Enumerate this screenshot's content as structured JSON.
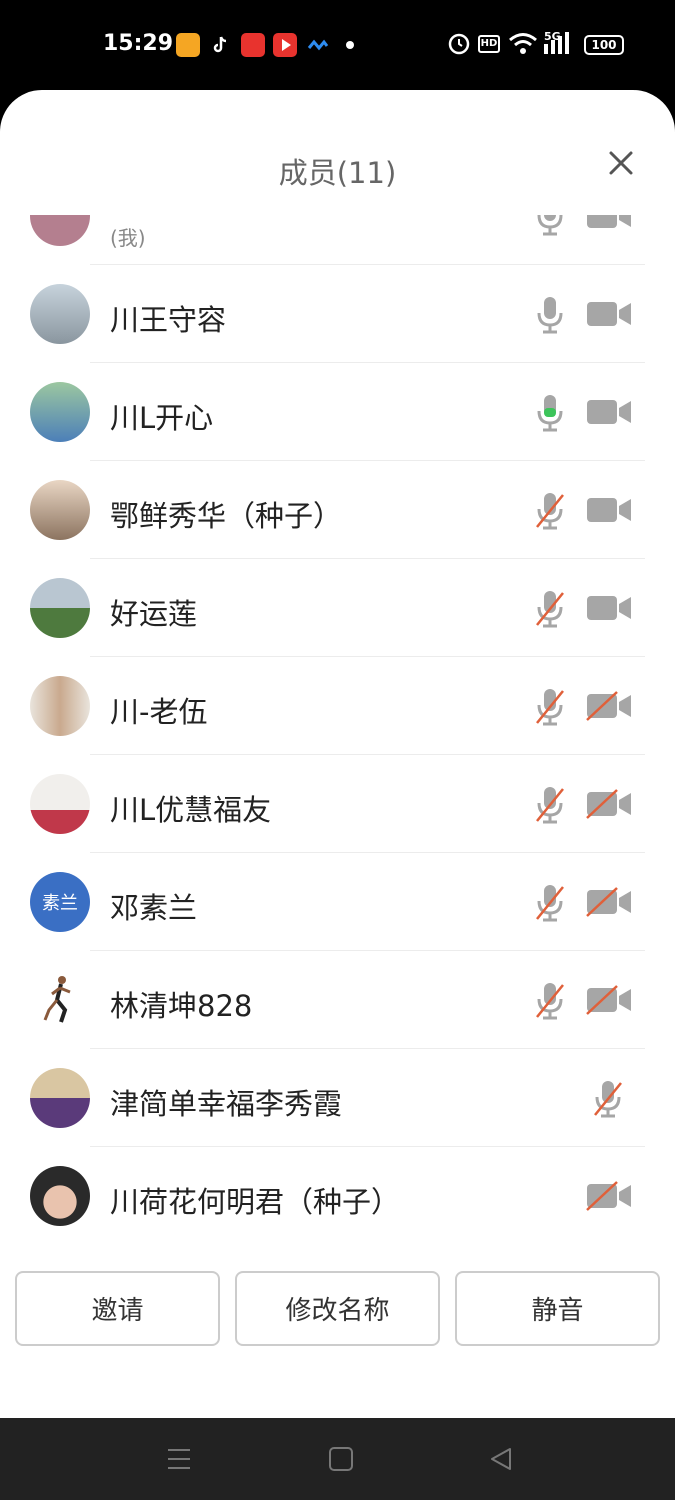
{
  "status_bar": {
    "time": "15:29",
    "apps": [
      "kuaishou-icon",
      "douyin-icon",
      "toutiao-icon",
      "video-app-icon",
      "tencent-meeting-icon"
    ],
    "right_icons": [
      "alarm-icon",
      "hd-icon",
      "wifi-icon",
      "5g-signal-icon"
    ],
    "hd_label": "HD",
    "network_label": "5G",
    "battery": "100"
  },
  "sheet": {
    "title": "成员(11)"
  },
  "members": [
    {
      "name": "",
      "sub": "(我)",
      "mic": "on",
      "cam": "on",
      "avatar_type": "photo"
    },
    {
      "name": "川王守容",
      "mic": "on",
      "cam": "on",
      "avatar_type": "photo"
    },
    {
      "name": "川L开心",
      "mic": "speaking",
      "cam": "on",
      "avatar_type": "photo"
    },
    {
      "name": "鄂鲜秀华（种子）",
      "mic": "off",
      "cam": "on",
      "avatar_type": "photo"
    },
    {
      "name": "好运莲",
      "mic": "off",
      "cam": "on",
      "avatar_type": "photo"
    },
    {
      "name": "川-老伍",
      "mic": "off",
      "cam": "off",
      "avatar_type": "photo"
    },
    {
      "name": "川L优慧福友",
      "mic": "off",
      "cam": "off",
      "avatar_type": "photo"
    },
    {
      "name": "邓素兰",
      "mic": "off",
      "cam": "off",
      "avatar_type": "text",
      "avatar_text": "素兰"
    },
    {
      "name": "林清坤828",
      "mic": "off",
      "cam": "off",
      "avatar_type": "runner"
    },
    {
      "name": "津简单幸福李秀霞",
      "mic": "off",
      "cam": "none",
      "avatar_type": "photo"
    },
    {
      "name": "川荷花何明君（种子）",
      "mic": "none",
      "cam": "off",
      "avatar_type": "photo"
    }
  ],
  "actions": {
    "invite": "邀请",
    "rename": "修改名称",
    "mute": "静音"
  },
  "nav_bar": {
    "buttons": [
      "menu-icon",
      "home-icon",
      "back-icon"
    ]
  },
  "colors": {
    "icon_gray": "#a6a6a6",
    "mute_red": "#e0603a",
    "speaking_green": "#3cc45a",
    "avatar_blue": "#3a6fc4"
  }
}
